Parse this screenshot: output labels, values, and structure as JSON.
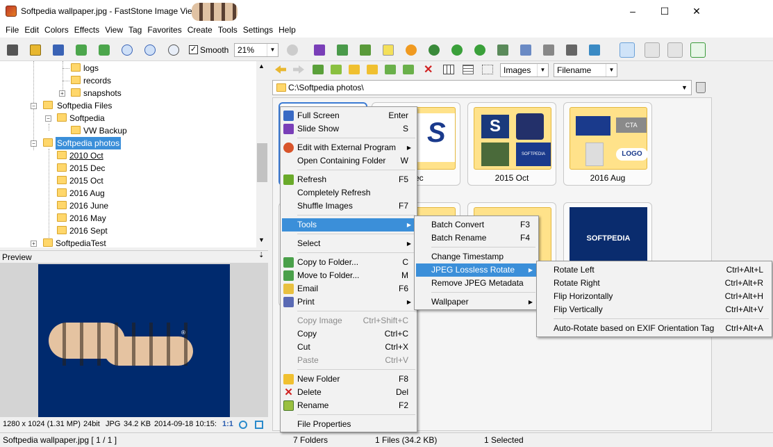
{
  "window": {
    "title": "Softpedia wallpaper.jpg - FastStone Image Vie"
  },
  "menubar": [
    "File",
    "Edit",
    "Colors",
    "Effects",
    "View",
    "Tag",
    "Favorites",
    "Create",
    "Tools",
    "Settings",
    "Help"
  ],
  "toolbar": {
    "smooth_label": "Smooth",
    "smooth_checked": true,
    "zoom": "21%"
  },
  "nav": {
    "filter": "Images",
    "sort": "Filename",
    "path": "C:\\Softpedia photos\\"
  },
  "tree": [
    {
      "label": "logs"
    },
    {
      "label": "records"
    },
    {
      "label": "snapshots"
    },
    {
      "label": "Softpedia Files"
    },
    {
      "label": "Softpedia"
    },
    {
      "label": "VW Backup"
    },
    {
      "label": "Softpedia photos",
      "selected": true
    },
    {
      "label": "2010 Oct"
    },
    {
      "label": "2015 Dec"
    },
    {
      "label": "2015 Oct"
    },
    {
      "label": "2016 Aug"
    },
    {
      "label": "2016 June"
    },
    {
      "label": "2016 May"
    },
    {
      "label": "2016 Sept"
    },
    {
      "label": "SoftpediaTest"
    }
  ],
  "preview": {
    "header": "Preview",
    "logo_mark": "®"
  },
  "info": {
    "dims": "1280 x 1024 (1.31 MP)",
    "depth": "24bit",
    "format": "JPG",
    "size": "34.2 KB",
    "date": "2014-09-18 10:15:",
    "ratio": "1:1"
  },
  "thumbnails": [
    {
      "label": ""
    },
    {
      "label": "Dec"
    },
    {
      "label": "2015 Oct"
    },
    {
      "label": "2016 Aug"
    }
  ],
  "thumb_texts": {
    "cta": "CTA",
    "logo": "LOGO",
    "softpedia": "SOFTPEDIA",
    "s": "S"
  },
  "context_menu": {
    "full_screen": "Full Screen",
    "full_screen_sc": "Enter",
    "slide_show": "Slide Show",
    "slide_show_sc": "S",
    "edit_external": "Edit with External Program",
    "open_folder": "Open Containing Folder",
    "open_folder_sc": "W",
    "refresh": "Refresh",
    "refresh_sc": "F5",
    "completely_refresh": "Completely Refresh",
    "shuffle": "Shuffle Images",
    "shuffle_sc": "F7",
    "tools": "Tools",
    "select": "Select",
    "copy_to": "Copy to Folder...",
    "copy_to_sc": "C",
    "move_to": "Move to Folder...",
    "move_to_sc": "M",
    "email": "Email",
    "email_sc": "F6",
    "print": "Print",
    "copy_image": "Copy Image",
    "copy_image_sc": "Ctrl+Shift+C",
    "copy": "Copy",
    "copy_sc": "Ctrl+C",
    "cut": "Cut",
    "cut_sc": "Ctrl+X",
    "paste": "Paste",
    "paste_sc": "Ctrl+V",
    "new_folder": "New Folder",
    "new_folder_sc": "F8",
    "delete": "Delete",
    "delete_sc": "Del",
    "rename": "Rename",
    "rename_sc": "F2",
    "file_properties": "File Properties"
  },
  "tools_menu": {
    "batch_convert": "Batch Convert",
    "batch_convert_sc": "F3",
    "batch_rename": "Batch Rename",
    "batch_rename_sc": "F4",
    "change_timestamp": "Change Timestamp",
    "jpeg_rotate": "JPEG Lossless Rotate",
    "remove_meta": "Remove JPEG Metadata",
    "wallpaper": "Wallpaper"
  },
  "rotate_menu": {
    "rotate_left": "Rotate Left",
    "rotate_left_sc": "Ctrl+Alt+L",
    "rotate_right": "Rotate Right",
    "rotate_right_sc": "Ctrl+Alt+R",
    "flip_h": "Flip Horizontally",
    "flip_h_sc": "Ctrl+Alt+H",
    "flip_v": "Flip Vertically",
    "flip_v_sc": "Ctrl+Alt+V",
    "auto_rotate": "Auto-Rotate based on EXIF Orientation Tag",
    "auto_rotate_sc": "Ctrl+Alt+A"
  },
  "statusbar": {
    "file": "Softpedia wallpaper.jpg [ 1 / 1 ]",
    "folders": "7 Folders",
    "files": "1 Files (34.2 KB)",
    "selected": "1 Selected"
  },
  "colors": {
    "highlight": "#3b8fd9",
    "folder": "#ffd76b",
    "preview_bg": "#002a6e"
  }
}
